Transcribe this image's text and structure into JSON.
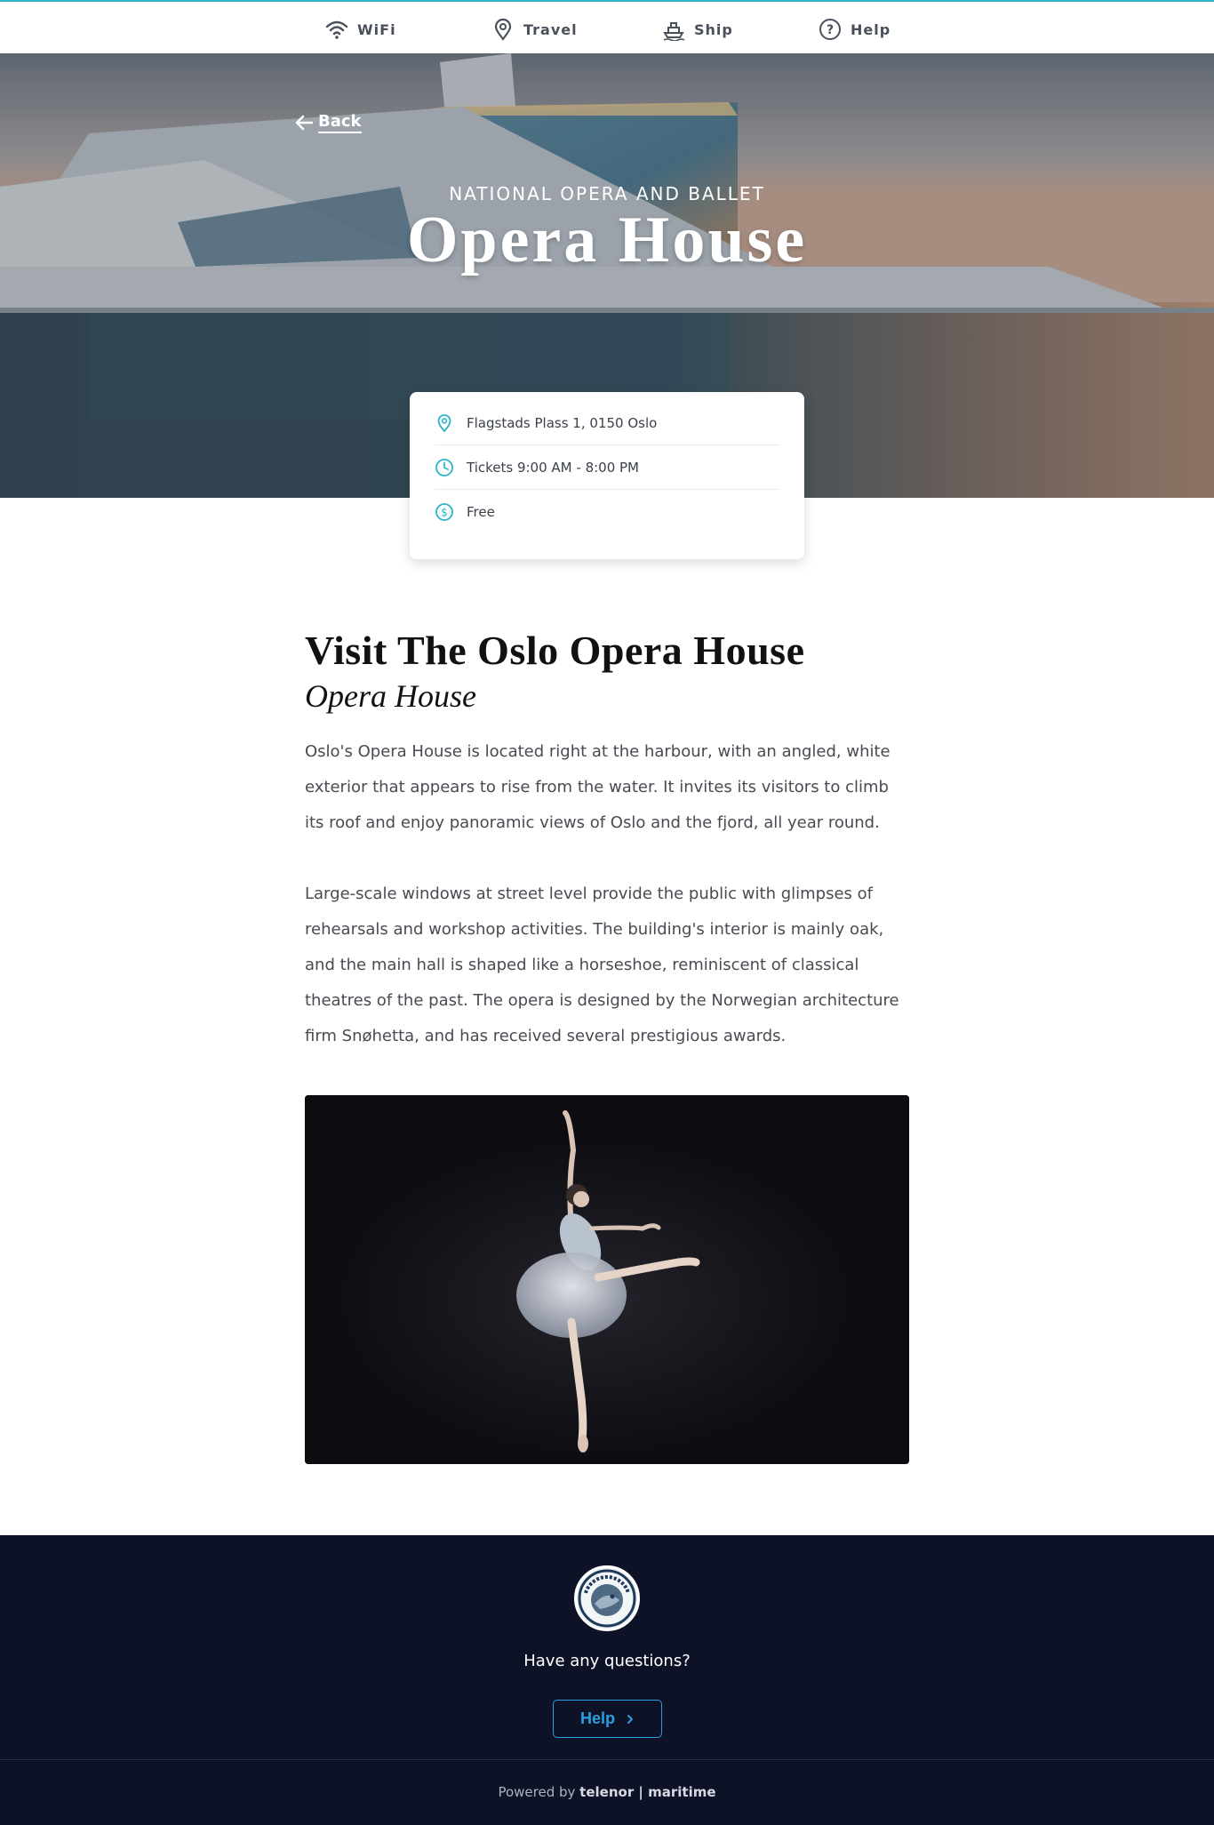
{
  "nav": {
    "items": [
      {
        "label": "WiFi",
        "icon": "wifi-icon"
      },
      {
        "label": "Travel",
        "icon": "location-pin-icon"
      },
      {
        "label": "Ship",
        "icon": "ship-icon"
      },
      {
        "label": "Help",
        "icon": "help-circle-icon"
      }
    ]
  },
  "hero": {
    "back_label": "Back",
    "kicker": "NATIONAL OPERA AND BALLET",
    "title": "Opera House"
  },
  "info": {
    "address": "Flagstads Plass 1, 0150 Oslo",
    "hours": "Tickets 9:00 AM - 8:00 PM",
    "price": "Free"
  },
  "article": {
    "heading": "Visit The Oslo Opera House",
    "subheading": "Opera House",
    "paragraphs": [
      "Oslo's Opera House is located right at the harbour, with an angled, white exterior that appears to rise from the water. It invites its visitors to climb its roof and enjoy panoramic views of Oslo and the fjord, all year round.",
      "Large-scale windows at street level provide the public with glimpses of rehearsals and workshop activities. The building's interior is mainly oak, and the main hall is shaped like a horseshoe, reminiscent of classical theatres of the past. The opera is designed by the Norwegian architecture firm Snøhetta, and has received several prestigious awards."
    ]
  },
  "footer": {
    "logo_text": "SMYRIL LINE",
    "question": "Have any questions?",
    "help_label": "Help",
    "powered_prefix": "Powered by",
    "powered_brand": "telenor | maritime"
  },
  "colors": {
    "accent": "#2bb5c9",
    "footer_bg": "#0e1226",
    "help_button": "#2aa0e0"
  }
}
